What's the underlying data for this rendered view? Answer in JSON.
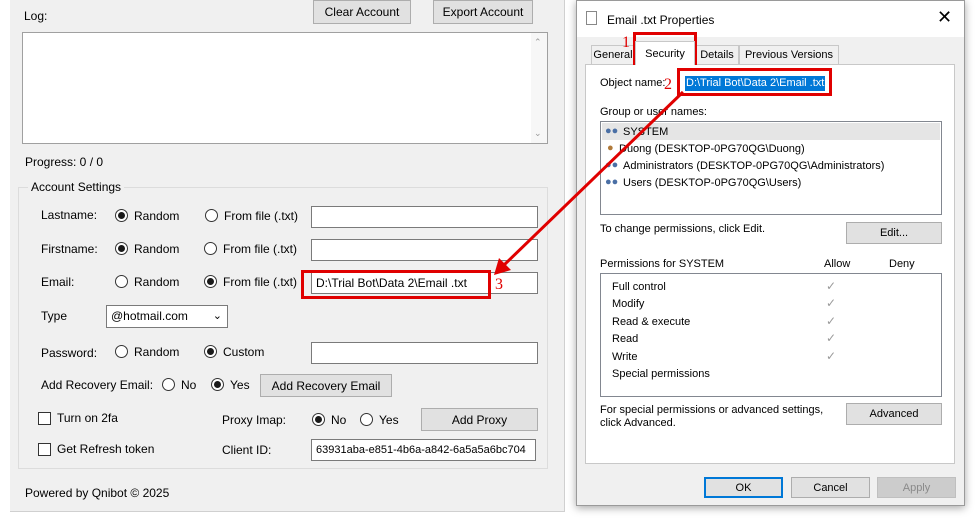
{
  "app": {
    "log_label": "Log:",
    "clear_account": "Clear Account",
    "export_account": "Export Account",
    "progress": "Progress: 0 / 0",
    "account_settings": "Account Settings",
    "lastname_label": "Lastname:",
    "firstname_label": "Firstname:",
    "email_label": "Email:",
    "random": "Random",
    "from_file": "From file (.txt)",
    "email_value": "D:\\Trial Bot\\Data 2\\Email .txt",
    "type_label": "Type",
    "type_value": "@hotmail.com",
    "password_label": "Password:",
    "custom": "Custom",
    "add_recovery_label": "Add Recovery Email:",
    "no": "No",
    "yes": "Yes",
    "add_recovery_button": "Add Recovery Email",
    "turn_on_2fa": "Turn on 2fa",
    "proxy_imap_label": "Proxy Imap:",
    "add_proxy": "Add Proxy",
    "get_refresh_token": "Get Refresh token",
    "client_id_label": "Client ID:",
    "client_id_value": "63931aba-e851-4b6a-a842-6a5a5a6bc704",
    "footer": "Powered by Qnibot © 2025"
  },
  "dialog": {
    "title": "Email .txt Properties",
    "tabs": [
      "General",
      "Security",
      "Details",
      "Previous Versions"
    ],
    "object_name_label": "Object name:",
    "object_name_value": "D:\\Trial Bot\\Data 2\\Email .txt",
    "group_label": "Group or user names:",
    "users": [
      "SYSTEM",
      "Duong (DESKTOP-0PG70QG\\Duong)",
      "Administrators (DESKTOP-0PG70QG\\Administrators)",
      "Users (DESKTOP-0PG70QG\\Users)"
    ],
    "change_perm_text": "To change permissions, click Edit.",
    "edit_button": "Edit...",
    "perm_for": "Permissions for SYSTEM",
    "allow": "Allow",
    "deny": "Deny",
    "permissions": [
      "Full control",
      "Modify",
      "Read & execute",
      "Read",
      "Write",
      "Special permissions"
    ],
    "special_text_1": "For special permissions or advanced settings,",
    "special_text_2": "click Advanced.",
    "advanced_button": "Advanced",
    "ok": "OK",
    "cancel": "Cancel",
    "apply": "Apply"
  },
  "annotations": [
    "1",
    "2",
    "3"
  ],
  "colors": {
    "annotation_red": "#e00000",
    "selection_blue": "#0078d7",
    "ok_border": "#0078d7"
  }
}
